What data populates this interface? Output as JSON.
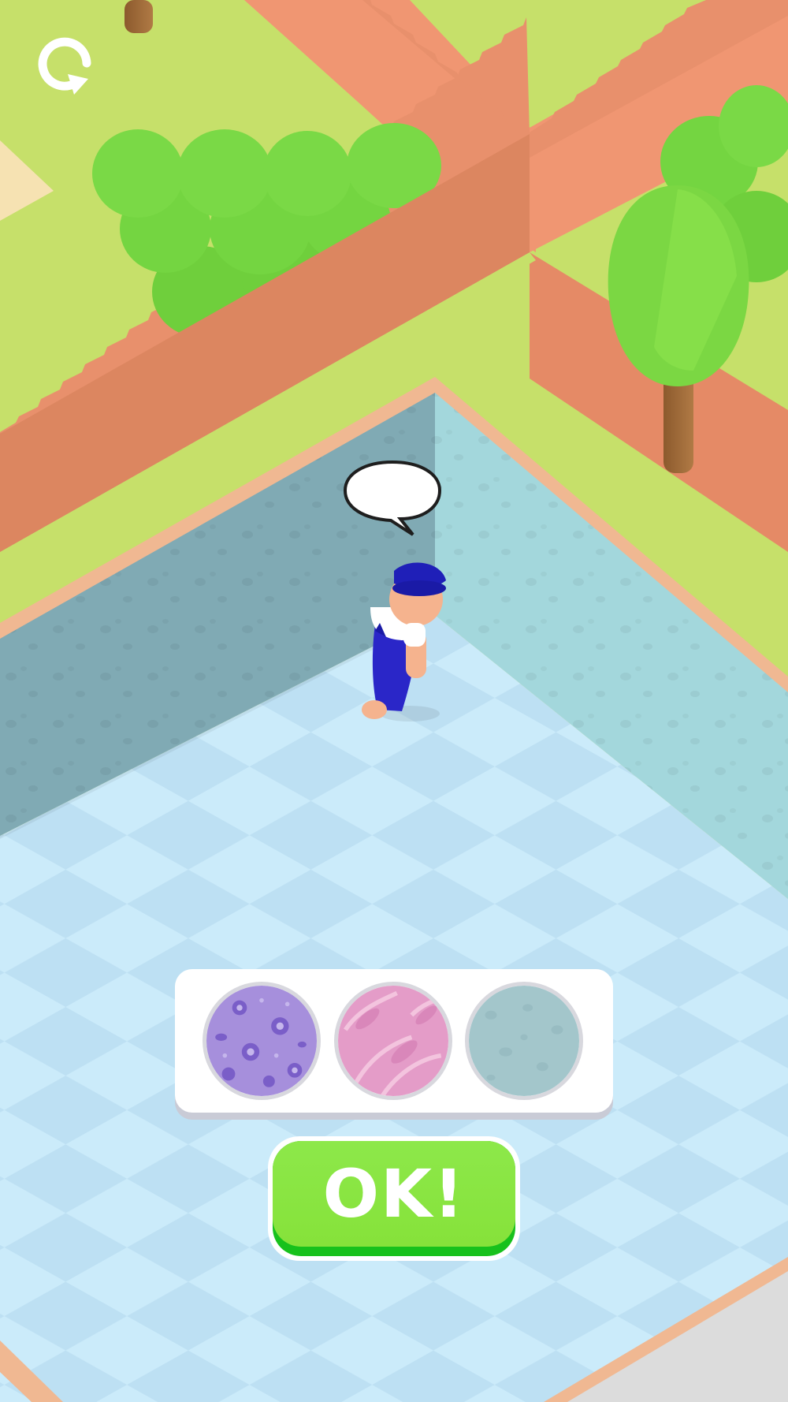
{
  "game": {
    "restart_icon": "restart-arrow-icon",
    "speech_bubble_text": "",
    "character": "worker-in-blue-overalls"
  },
  "palette": {
    "options": [
      {
        "name": "purple-floral-wallpaper",
        "color": "#a68fdc"
      },
      {
        "name": "pink-leaf-wallpaper",
        "color": "#e49cc8"
      },
      {
        "name": "teal-pebble-wallpaper",
        "color": "#a3c6cb"
      }
    ]
  },
  "ok_button": {
    "label": "OK!"
  },
  "colors": {
    "grass": "#c6e06a",
    "dirt_path": "#f09672",
    "bush": "#7ad946",
    "wall_left": "#80aab4",
    "wall_right": "#a3d7dc",
    "floor_light": "#cbebfa",
    "floor_dark": "#bde0f3",
    "ok_green": "#86e23a"
  }
}
